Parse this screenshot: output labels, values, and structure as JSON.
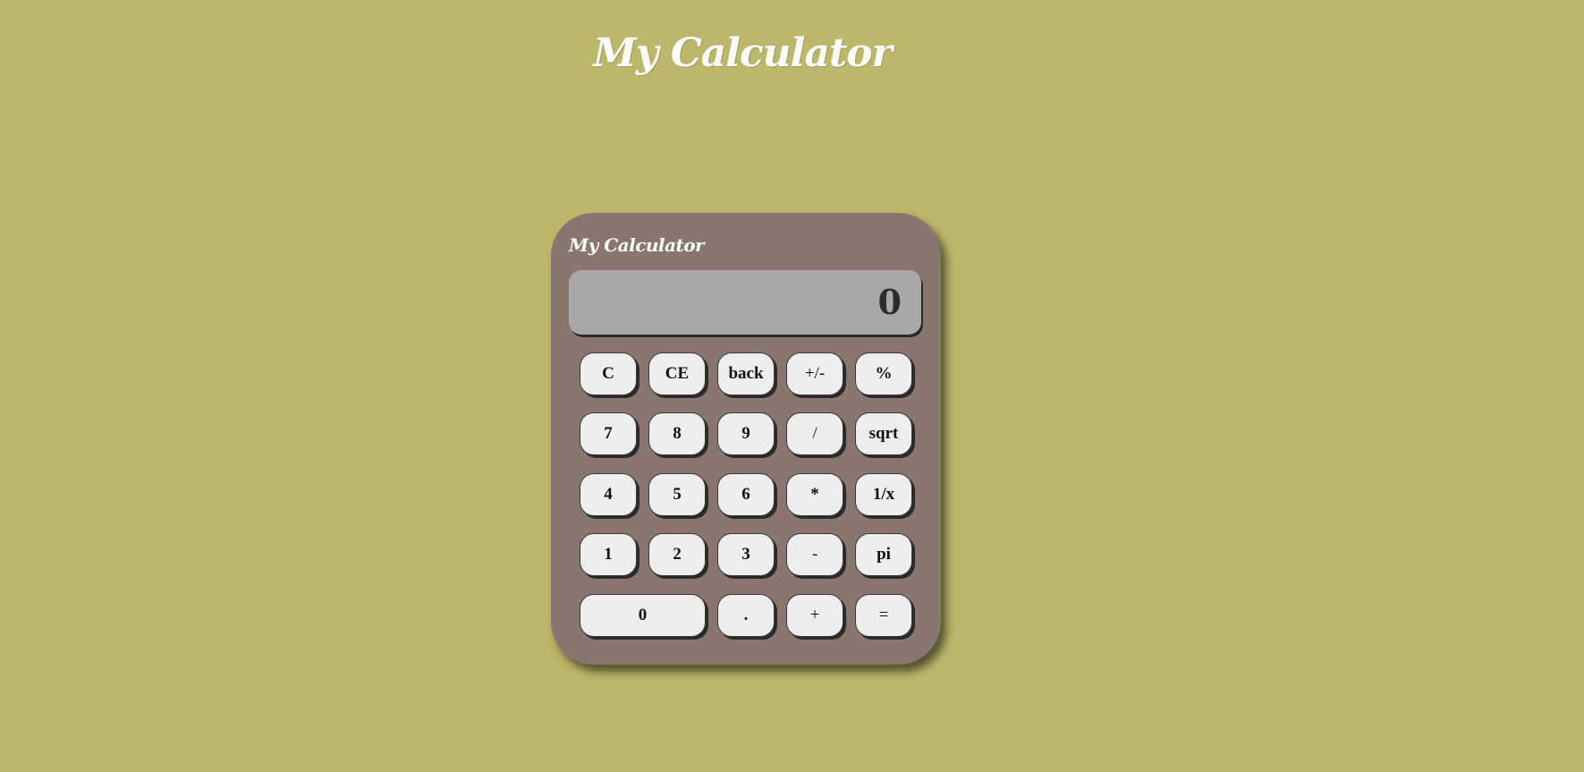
{
  "page": {
    "title": "My Calculator",
    "background_color": "#bdb76b"
  },
  "calculator": {
    "label": "My Calculator",
    "body_color": "#89766e",
    "display": {
      "value": "0",
      "color": "#a8a8a8"
    },
    "buttons": {
      "clear": "C",
      "clear_entry": "CE",
      "back": "back",
      "sign": "+/-",
      "percent": "%",
      "seven": "7",
      "eight": "8",
      "nine": "9",
      "divide": "/",
      "sqrt": "sqrt",
      "four": "4",
      "five": "5",
      "six": "6",
      "multiply": "*",
      "reciprocal": "1/x",
      "one": "1",
      "two": "2",
      "three": "3",
      "minus": "-",
      "pi": "pi",
      "zero": "0",
      "decimal": ".",
      "plus": "+",
      "equals": "="
    },
    "button_color": "#eeeeee"
  }
}
